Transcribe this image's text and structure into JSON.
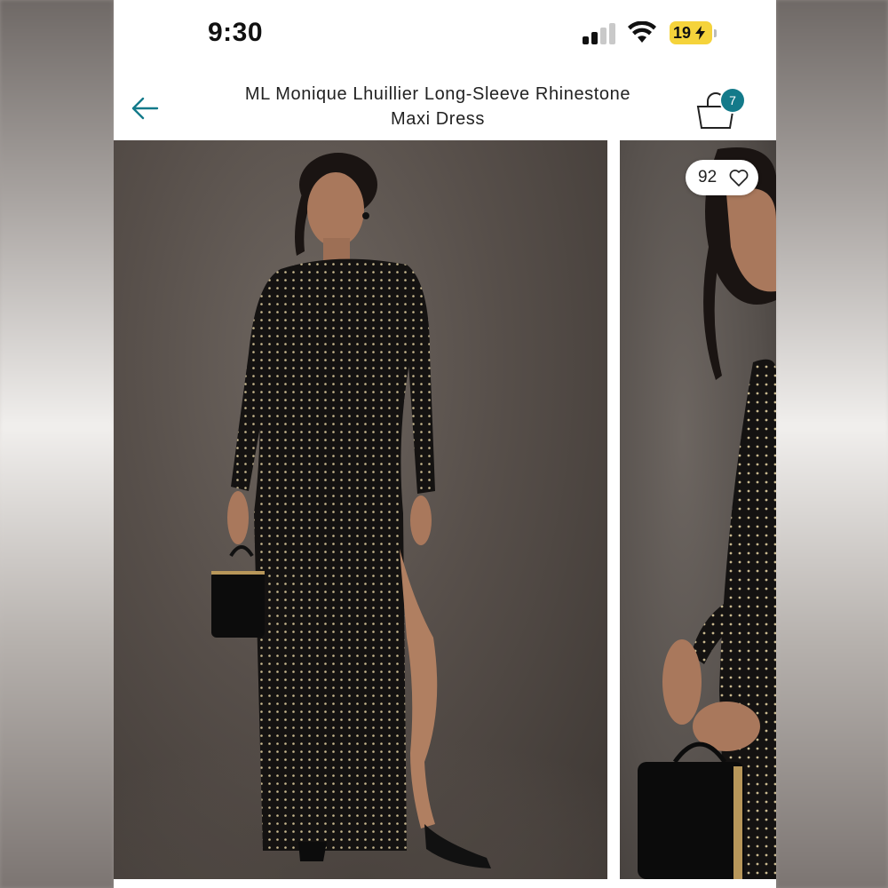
{
  "status_bar": {
    "time": "9:30",
    "battery_level": "19",
    "battery_color": "#f5d33b",
    "signal_icon": "cellular-signal-icon",
    "wifi_icon": "wifi-icon",
    "charging_icon": "bolt-icon"
  },
  "header": {
    "back_icon": "arrow-left-icon",
    "title_line1": "ML Monique Lhuillier Long-Sleeve Rhinestone",
    "title_line2": "Maxi Dress",
    "bag_icon": "shopping-bag-icon",
    "bag_count": "7",
    "accent_color": "#137a8a"
  },
  "gallery": {
    "main_image": "model-in-black-rhinestone-maxi-dress",
    "second_image": "closeup-model-holding-black-handbag",
    "like_count": "92",
    "heart_icon": "heart-outline-icon"
  }
}
